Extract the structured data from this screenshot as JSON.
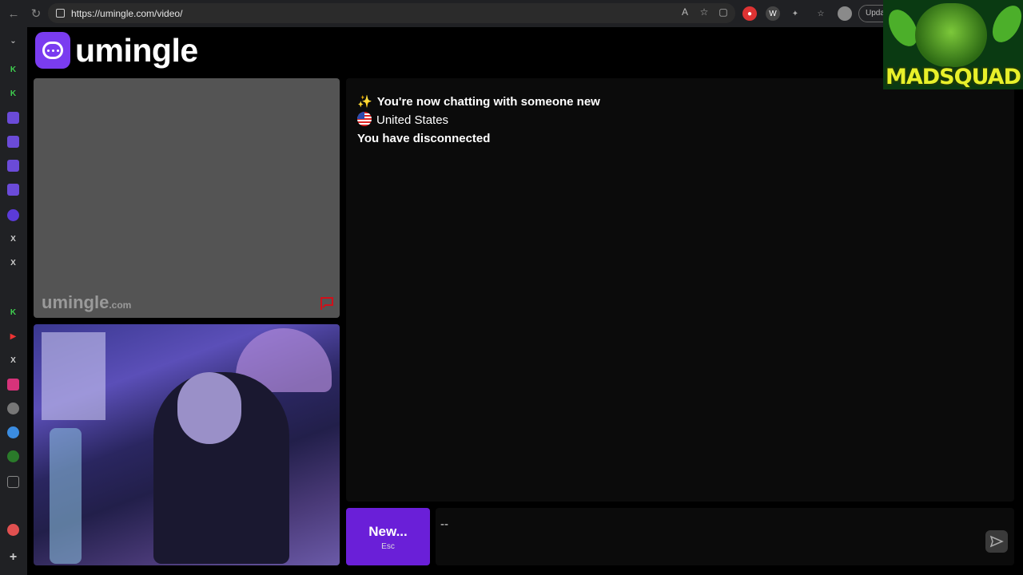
{
  "browser": {
    "url": "https://umingle.com/video/",
    "update_label": "Upda"
  },
  "app": {
    "brand_name": "umingle",
    "watermark_name": "umingle",
    "watermark_tld": ".com",
    "accent_color": "#6a1fd8"
  },
  "chat": {
    "messages": [
      {
        "icon": "sparkles-icon",
        "text": "You're now chatting with someone new",
        "bold": true
      },
      {
        "icon": "us-flag-icon",
        "text": "United States",
        "bold": false
      },
      {
        "icon": null,
        "text": "You have disconnected",
        "bold": true
      }
    ]
  },
  "controls": {
    "new_label": "New...",
    "new_shortcut": "Esc",
    "input_value": "--"
  },
  "overlay": {
    "text": "MADSQUAD"
  }
}
